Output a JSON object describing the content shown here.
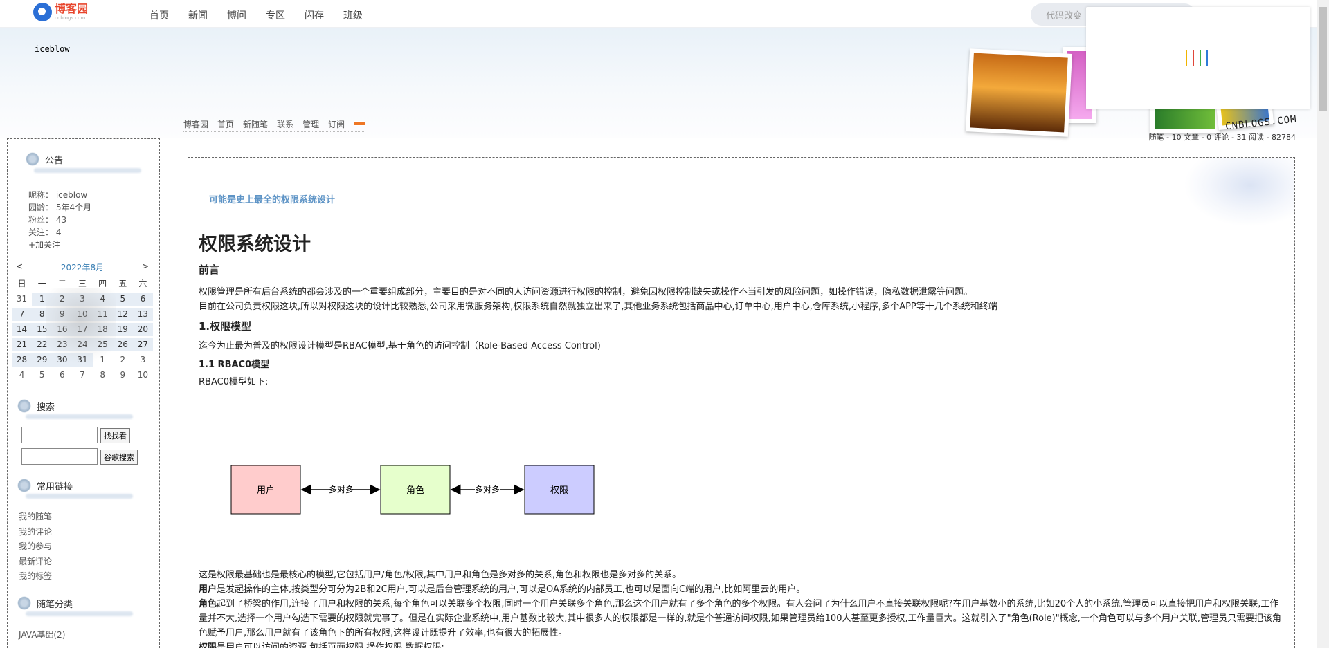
{
  "topnav": {
    "logo_cn": "博客园",
    "logo_en": "cnblogs.com",
    "items": [
      "首页",
      "新闻",
      "博问",
      "专区",
      "闪存",
      "班级"
    ],
    "search_placeholder": "代码改变"
  },
  "header": {
    "blog_title": "iceblow",
    "subnav": [
      "博客园",
      "首页",
      "新随笔",
      "联系",
      "管理",
      "订阅"
    ],
    "logo_text": "CNBLOGS.COM",
    "stats": "随笔 - 10  文章 - 0  评论 - 31  阅读 - 82784"
  },
  "sidebar": {
    "notice_title": "公告",
    "profile": {
      "nickname": "昵称：  iceblow",
      "age": "园龄：  5年4个月",
      "fans": "粉丝：  43",
      "follow": "关注：  4",
      "add_follow": "+加关注"
    },
    "calendar": {
      "prev": "<",
      "month": "2022年8月",
      "next": ">",
      "weekdays": [
        "日",
        "一",
        "二",
        "三",
        "四",
        "五",
        "六"
      ],
      "days": [
        [
          "31",
          "1",
          "2",
          "3",
          "4",
          "5",
          "6"
        ],
        [
          "7",
          "8",
          "9",
          "10",
          "11",
          "12",
          "13"
        ],
        [
          "14",
          "15",
          "16",
          "17",
          "18",
          "19",
          "20"
        ],
        [
          "21",
          "22",
          "23",
          "24",
          "25",
          "26",
          "27"
        ],
        [
          "28",
          "29",
          "30",
          "31",
          "1",
          "2",
          "3"
        ],
        [
          "4",
          "5",
          "6",
          "7",
          "8",
          "9",
          "10"
        ]
      ]
    },
    "search_title": "搜索",
    "search_btn": "找找看",
    "google_btn": "谷歌搜索",
    "links_title": "常用链接",
    "links": [
      "我的随笔",
      "我的评论",
      "我的参与",
      "最新评论",
      "我的标签"
    ],
    "category_title": "随笔分类",
    "categories": [
      "JAVA基础(2)"
    ]
  },
  "post": {
    "link_title": "可能是史上最全的权限系统设计",
    "h1": "权限系统设计",
    "preface": "前言",
    "p1": "权限管理是所有后台系统的都会涉及的一个重要组成部分，主要目的是对不同的人访问资源进行权限的控制，避免因权限控制缺失或操作不当引发的风险问题，如操作错误，隐私数据泄露等问题。",
    "p2": "目前在公司负责权限这块,所以对权限这块的设计比较熟悉,公司采用微服务架构,权限系统自然就独立出来了,其他业务系统包括商品中心,订单中心,用户中心,仓库系统,小程序,多个APP等十几个系统和终端",
    "h_model": "1.权限模型",
    "p3": "迄今为止最为普及的权限设计模型是RBAC模型,基于角色的访问控制（Role-Based Access Control)",
    "h_rbac0": "1.1 RBAC0模型",
    "p4": "RBAC0模型如下:",
    "diagram": {
      "user": "用户",
      "role": "角色",
      "perm": "权限",
      "rel1": "多对多",
      "rel2": "多对多"
    },
    "p5": "这是权限最基础也是最核心的模型,它包括用户/角色/权限,其中用户和角色是多对多的关系,角色和权限也是多对多的关系。",
    "p6_bold": "用户",
    "p6": "是发起操作的主体,按类型分可分为2B和2C用户,可以是后台管理系统的用户,可以是OA系统的内部员工,也可以是面向C端的用户,比如阿里云的用户。",
    "p7_bold": "角色",
    "p7": "起到了桥梁的作用,连接了用户和权限的关系,每个角色可以关联多个权限,同时一个用户关联多个角色,那么这个用户就有了多个角色的多个权限。有人会问了为什么用户不直接关联权限呢?在用户基数小的系统,比如20个人的小系统,管理员可以直接把用户和权限关联,工作量并不大,选择一个用户勾选下需要的权限就完事了。但是在实际企业系统中,用户基数比较大,其中很多人的权限都是一样的,就是个普通访问权限,如果管理员给100人甚至更多授权,工作量巨大。这就引入了\"角色(Role)\"概念,一个角色可以与多个用户关联,管理员只需要把该角色赋予用户,那么用户就有了该角色下的所有权限,这样设计既提升了效率,也有很大的拓展性。",
    "p8_bold": "权限",
    "p8": "是用户可以访问的资源,包括页面权限,操作权限,数据权限:"
  },
  "colors": {
    "user_fill": "#ffcccc",
    "role_fill": "#e6ffcc",
    "perm_fill": "#ccccff",
    "link": "#5e94c6",
    "brand": "#e8452c"
  }
}
